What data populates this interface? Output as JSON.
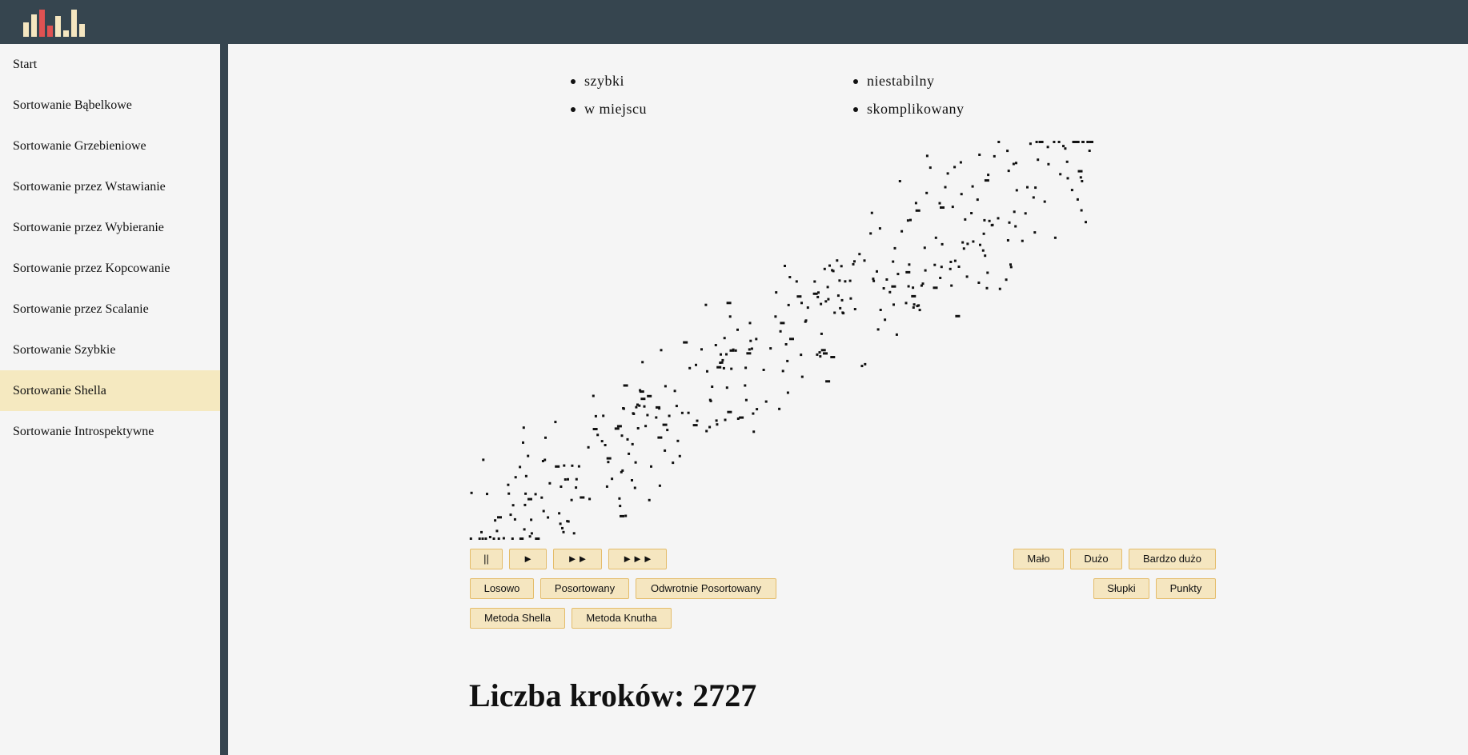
{
  "header": {
    "logo_colors": [
      "#f5e6c0",
      "#f5e6c0",
      "#e05252",
      "#e05252",
      "#f5e6c0",
      "#f5e6c0",
      "#f5e6c0",
      "#f5e6c0"
    ],
    "logo_icon": "bar-chart-logo"
  },
  "sidebar": {
    "items": [
      {
        "label": "Start"
      },
      {
        "label": "Sortowanie Bąbelkowe"
      },
      {
        "label": "Sortowanie Grzebieniowe"
      },
      {
        "label": "Sortowanie przez Wstawianie"
      },
      {
        "label": "Sortowanie przez Wybieranie"
      },
      {
        "label": "Sortowanie przez Kopcowanie"
      },
      {
        "label": "Sortowanie przez Scalanie"
      },
      {
        "label": "Sortowanie Szybkie"
      },
      {
        "label": "Sortowanie Shella",
        "active": true
      },
      {
        "label": "Sortowanie Introspektywne"
      }
    ],
    "active_color": "#f5e9c0"
  },
  "properties": {
    "left": [
      "szybki",
      "w miejscu"
    ],
    "right": [
      "niestabilny",
      "skomplikowany"
    ]
  },
  "speed_buttons": [
    "||",
    "►",
    "►►",
    "►►►"
  ],
  "size_buttons": [
    "Mało",
    "Dużo",
    "Bardzo dużo"
  ],
  "order_buttons": [
    "Losowo",
    "Posortowany",
    "Odwrotnie Posortowany"
  ],
  "view_buttons": [
    "Słupki",
    "Punkty"
  ],
  "method_buttons": [
    "Metoda Shella",
    "Metoda Knutha"
  ],
  "steps": {
    "label": "Liczba kroków: 2727"
  },
  "visualization": {
    "mode": "points",
    "dot_color": "#111111",
    "point_count": 1000
  }
}
